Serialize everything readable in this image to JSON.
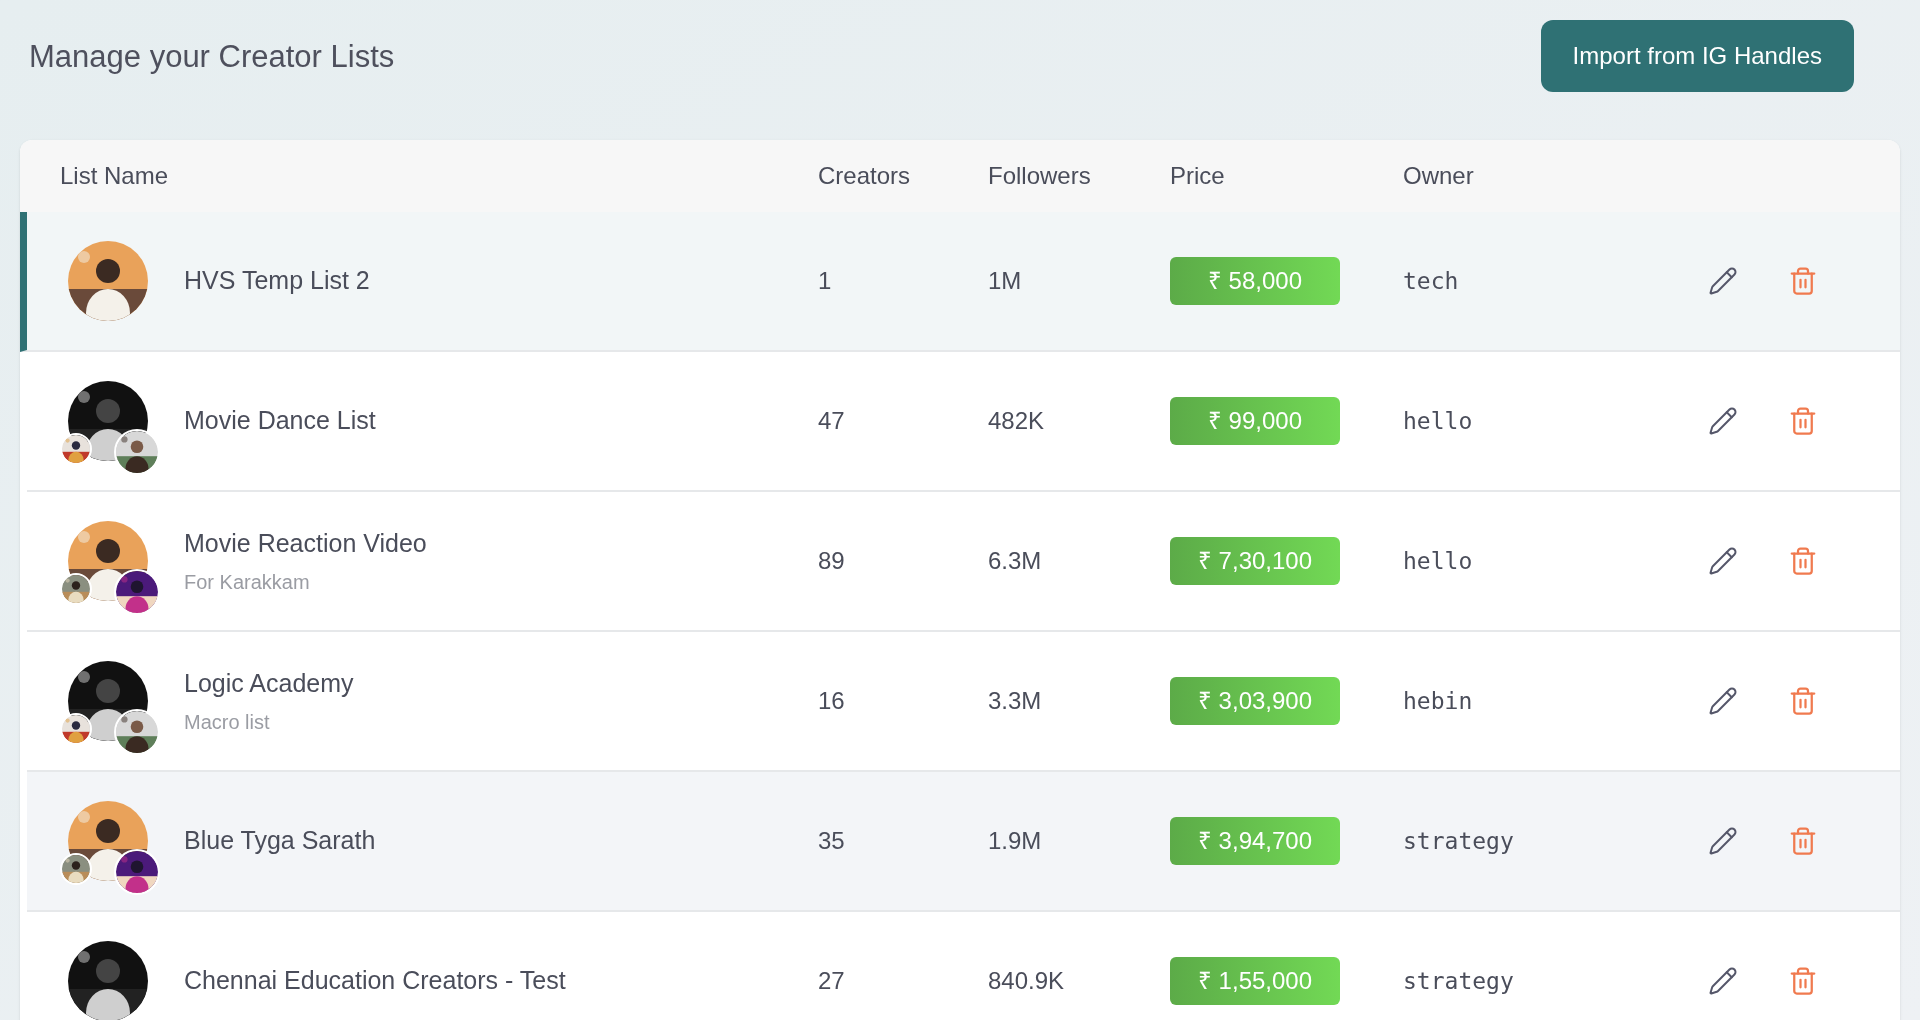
{
  "page": {
    "title": "Manage your Creator Lists"
  },
  "import_button": {
    "label": "Import from IG Handles"
  },
  "table": {
    "columns": [
      "List Name",
      "Creators",
      "Followers",
      "Price",
      "Owner"
    ],
    "rows": [
      {
        "name": "HVS Temp List 2",
        "creators": "1",
        "followers": "1M",
        "price": "₹ 58,000",
        "owner": "tech",
        "selected": true,
        "hovered": false
      },
      {
        "name": "Movie Dance List",
        "creators": "47",
        "followers": "482K",
        "price": "₹ 99,000",
        "owner": "hello",
        "selected": false,
        "hovered": false
      },
      {
        "name": "Movie Reaction Video",
        "subtitle": "For Karakkam",
        "creators": "89",
        "followers": "6.3M",
        "price": "₹ 7,30,100",
        "owner": "hello",
        "selected": false,
        "hovered": false
      },
      {
        "name": "Logic Academy",
        "subtitle": "Macro list",
        "creators": "16",
        "followers": "3.3M",
        "price": "₹ 3,03,900",
        "owner": "hebin",
        "selected": false,
        "hovered": false
      },
      {
        "name": "Blue Tyga Sarath",
        "creators": "35",
        "followers": "1.9M",
        "price": "₹ 3,94,700",
        "owner": "strategy",
        "selected": false,
        "hovered": true
      },
      {
        "name": "Chennai Education Creators - Test",
        "creators": "27",
        "followers": "840.9K",
        "price": "₹ 1,55,000",
        "owner": "strategy",
        "selected": false,
        "hovered": false
      }
    ]
  }
}
